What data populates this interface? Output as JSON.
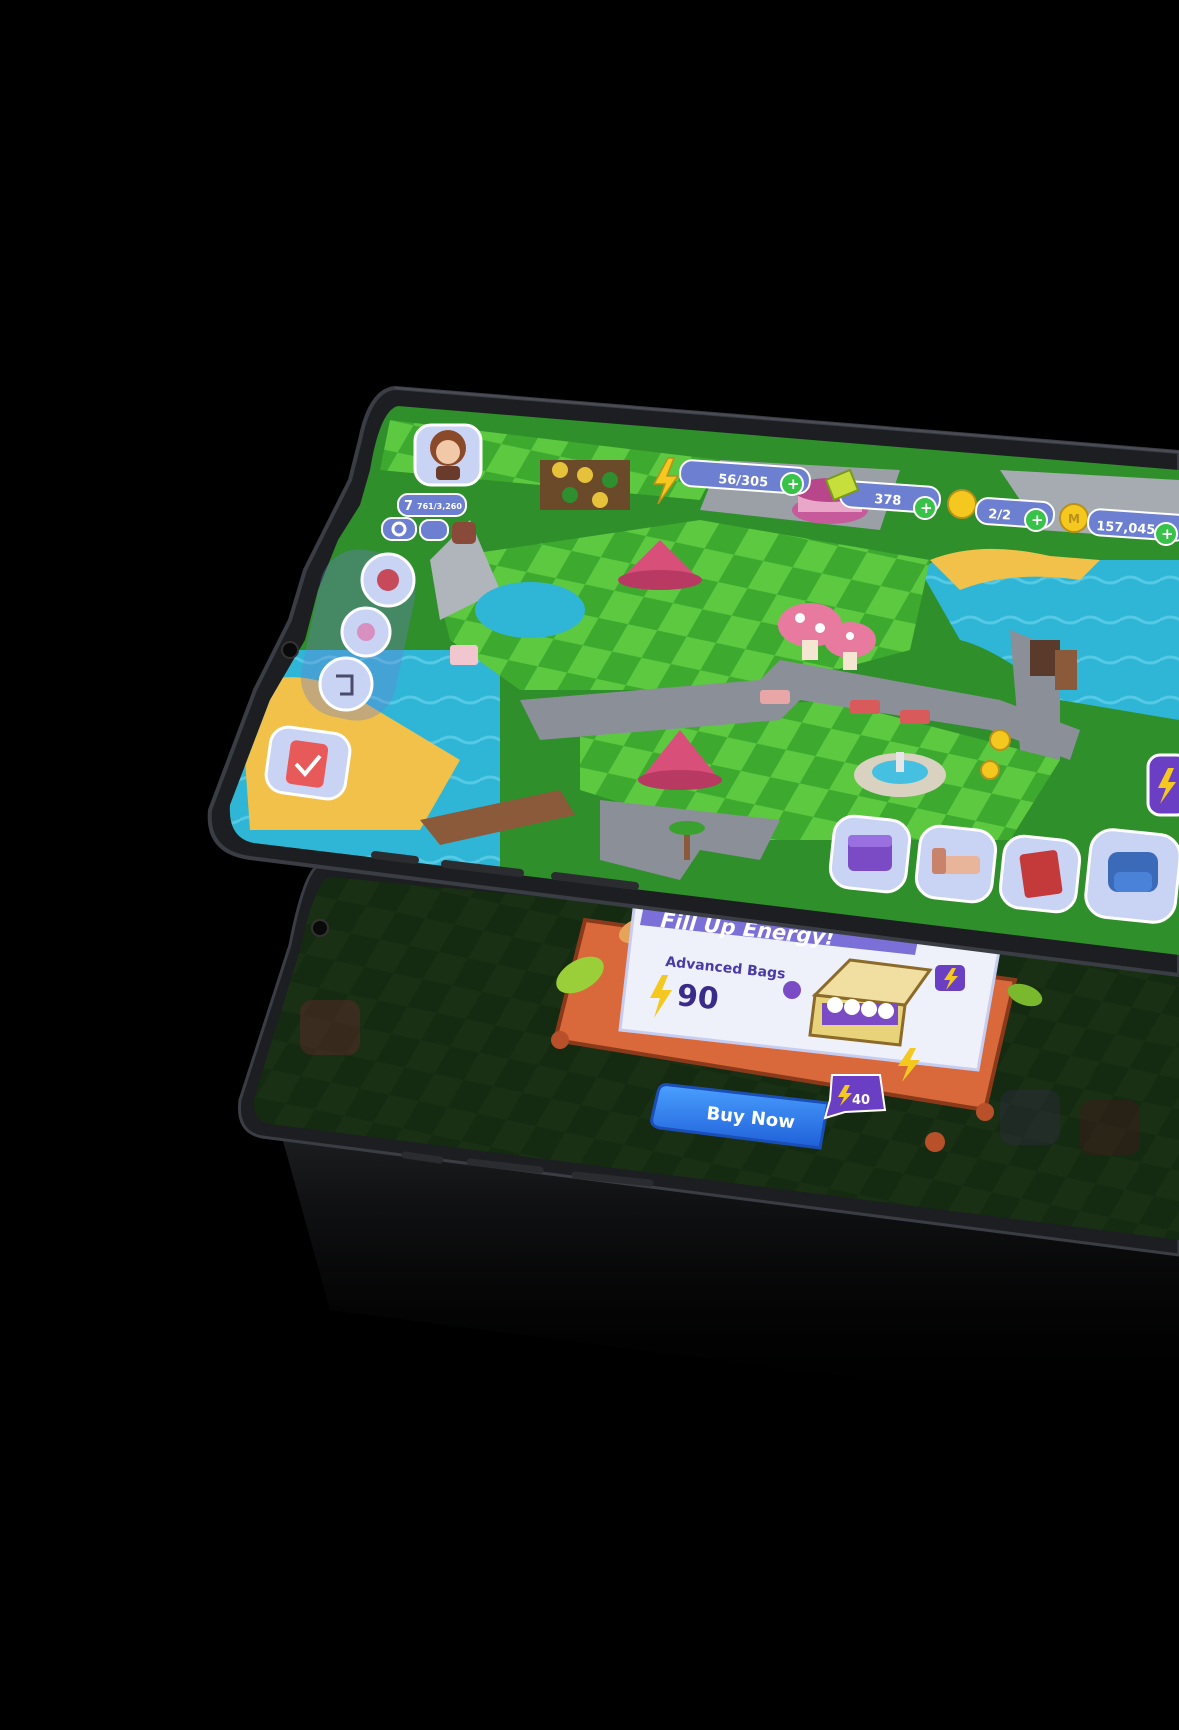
{
  "hud": {
    "level": "7",
    "xp": "761/3,260",
    "energy": "56/305",
    "gems": "378",
    "builders": "2/2",
    "coins": "157,045"
  },
  "popup": {
    "title": "Fill Up Energy!",
    "subtitle": "Advanced Bags",
    "amount": "90",
    "button_label": "Buy Now",
    "price": "40"
  },
  "icons": {
    "energy": "lightning-icon",
    "coin": "coin-icon",
    "plus": "plus-icon",
    "settings": "gear-icon"
  },
  "colors": {
    "background": "#000000",
    "device_frame": "#1c1e22",
    "grass_dark": "#3da92f",
    "grass_light": "#5cc940",
    "water": "#2fb6d6",
    "sand": "#f2c14a",
    "road": "#8b8f98",
    "hud_pill": "#6c7fd0",
    "plus_green": "#39c24a",
    "button_blue": "#2c7cf0",
    "popup_wood": "#d9693a",
    "badge_purple": "#6a3fc4"
  }
}
